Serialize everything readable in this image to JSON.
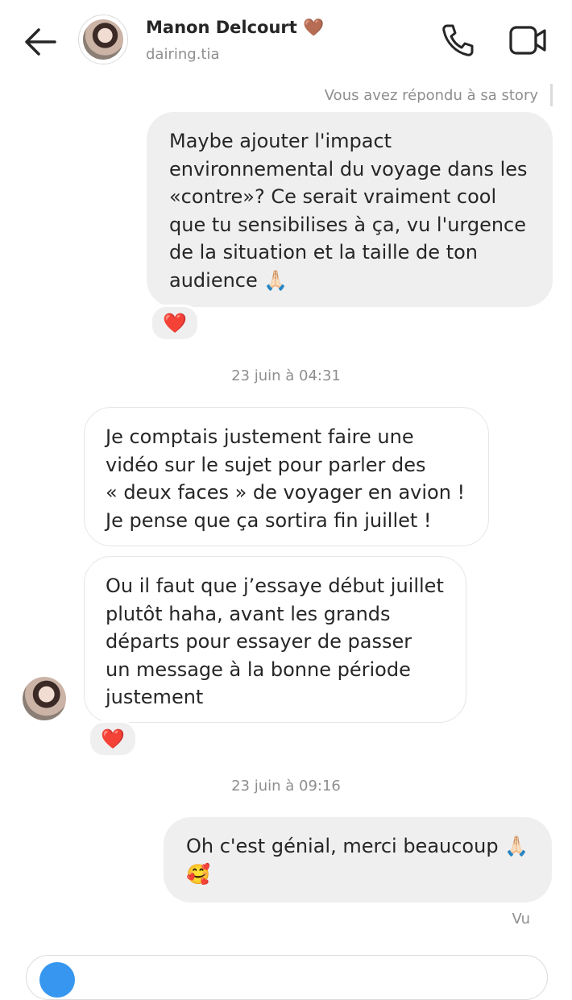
{
  "header": {
    "name": "Manon Delcourt",
    "name_emoji": "🤎",
    "username": "dairing.tia"
  },
  "story_note": "Vous avez répondu à sa story",
  "messages": [
    {
      "direction": "outgoing",
      "text": "Maybe ajouter l'impact environnemental du voyage dans les «contre»? Ce serait vraiment cool que tu sensibilises à ça, vu l'urgence de la situation et la taille de ton audience 🙏🏻",
      "lines": [
        "Maybe ajouter l'impact",
        "environnemental du voyage dans les",
        "«contre»? Ce serait vraiment cool",
        "que tu sensibilises à ça, vu l'urgence",
        "de la situation et la taille de ton",
        "audience 🙏🏻"
      ],
      "reaction": "❤️"
    },
    {
      "direction": "incoming",
      "lines": [
        "Je comptais justement faire une",
        "vidéo sur le sujet pour parler des",
        "« deux faces » de voyager en avion !",
        "Je pense que ça sortira fin juillet !"
      ]
    },
    {
      "direction": "incoming",
      "lines": [
        "Ou il faut que j’essaye début juillet",
        "plutôt haha, avant les grands",
        "départs pour essayer de passer",
        "un message à la bonne période",
        "justement"
      ],
      "reaction": "❤️"
    },
    {
      "direction": "outgoing",
      "lines": [
        "Oh c'est génial, merci beaucoup 🙏🏻",
        "🥰"
      ]
    }
  ],
  "timestamps": [
    "23 juin à 04:31",
    "23 juin à 09:16"
  ],
  "seen_label": "Vu",
  "colors": {
    "outgoing_bubble": "#efefef",
    "incoming_border": "#e6e6e6",
    "secondary_text": "#8e8e8e",
    "camera_button": "#3797f0"
  },
  "icons": [
    "back-arrow-icon",
    "phone-icon",
    "video-call-icon",
    "camera-icon"
  ]
}
